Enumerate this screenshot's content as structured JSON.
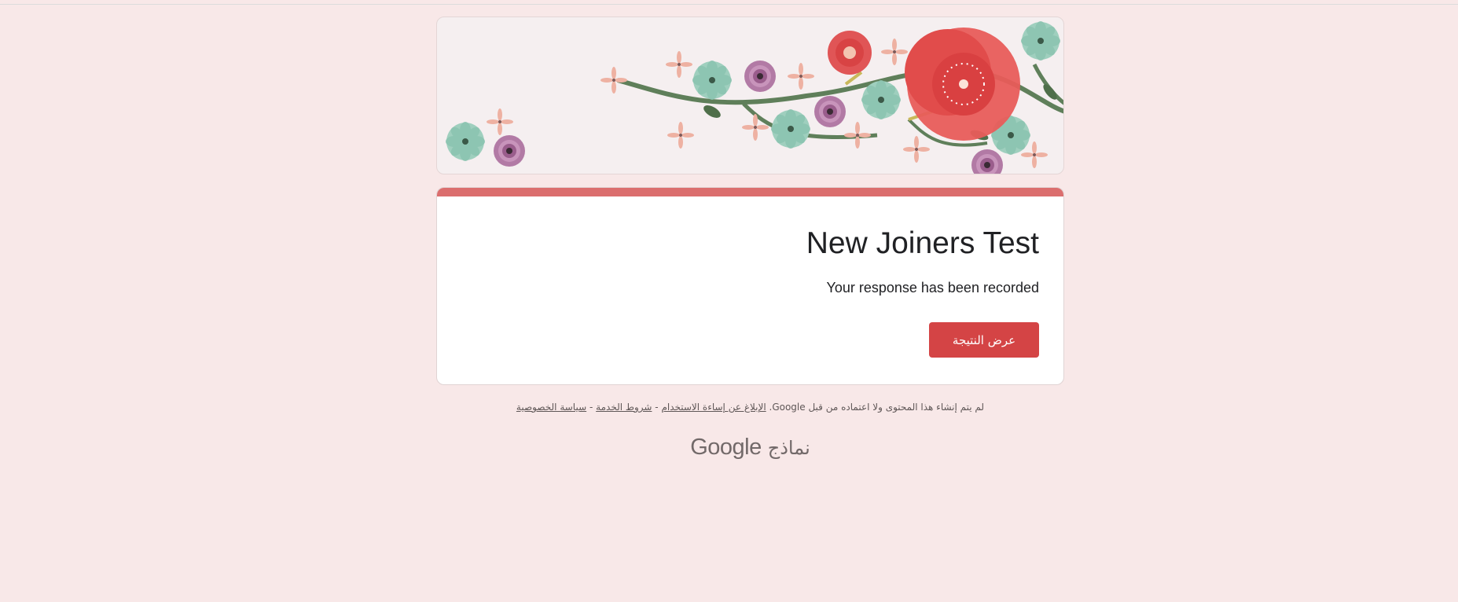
{
  "form": {
    "title": "New Joiners Test",
    "confirmation": "Your response has been recorded",
    "view_result_button": "عرض النتيجة"
  },
  "footer": {
    "disclaimer_text": "لم يتم إنشاء هذا المحتوى ولا اعتماده من قبل Google.",
    "report_abuse_link": "الإبلاغ عن إساءة الاستخدام",
    "separator": "-",
    "terms_link": "شروط الخدمة",
    "privacy_link": "سياسة الخصوصية",
    "brand_arabic": "نماذج",
    "brand_google": "Google"
  },
  "colors": {
    "page_background": "#f8e8e8",
    "card_accent": "#db6e6e",
    "button_background": "#d44445",
    "banner_background": "#f5eff0"
  }
}
